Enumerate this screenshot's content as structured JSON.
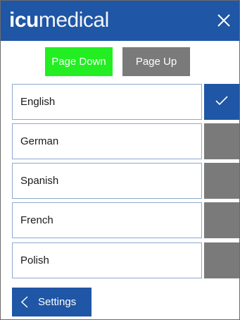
{
  "header": {
    "logo_bold": "icu",
    "logo_light": "medical",
    "close_icon": "close-icon"
  },
  "paging": {
    "page_down_label": "Page Down",
    "page_up_label": "Page Up"
  },
  "languages": [
    {
      "label": "English",
      "selected": true
    },
    {
      "label": "German",
      "selected": false
    },
    {
      "label": "Spanish",
      "selected": false
    },
    {
      "label": "French",
      "selected": false
    },
    {
      "label": "Polish",
      "selected": false
    }
  ],
  "footer": {
    "settings_label": "Settings",
    "back_icon": "chevron-left-icon"
  },
  "colors": {
    "brand_blue": "#1f56a5",
    "page_down_green": "#22ee22",
    "inactive_gray": "#7a7a7a"
  }
}
